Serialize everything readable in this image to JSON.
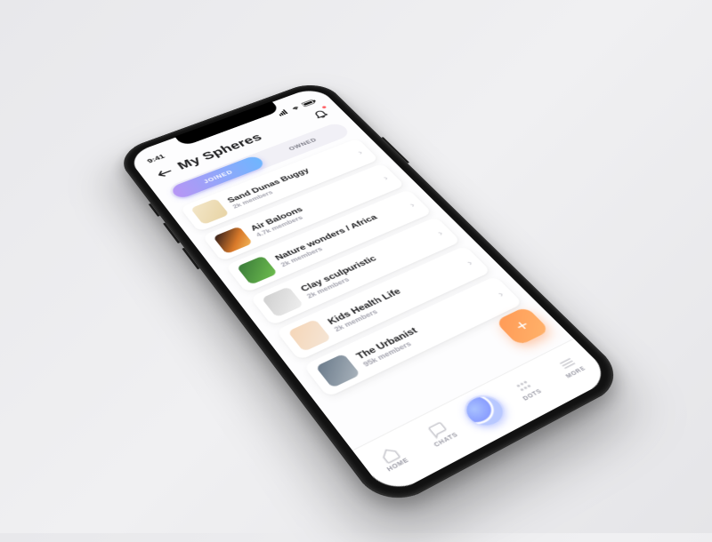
{
  "status": {
    "time": "9:41"
  },
  "header": {
    "title": "My Spheres"
  },
  "segmented": {
    "joined": "JOINED",
    "owned": "OWNED"
  },
  "spheres": [
    {
      "name": "Sand Dunas Buggy",
      "members": "2k members"
    },
    {
      "name": "Air Baloons",
      "members": "4.7k members"
    },
    {
      "name": "Nature wonders / Africa",
      "members": "2k members"
    },
    {
      "name": "Clay sculpuristic",
      "members": "2k members"
    },
    {
      "name": "Kids Health Life",
      "members": "2k members"
    },
    {
      "name": "The Urbanist",
      "members": "95k members"
    }
  ],
  "tabbar": {
    "home": "HOME",
    "chats": "CHATS",
    "dots": "DOTS",
    "more": "MORE"
  },
  "fab": {
    "label": "+"
  }
}
